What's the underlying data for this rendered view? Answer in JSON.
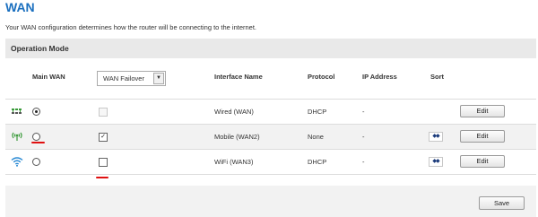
{
  "page": {
    "title": "WAN",
    "description": "Your WAN configuration determines how the router will be connecting to the internet."
  },
  "panel": {
    "title": "Operation Mode"
  },
  "table": {
    "headers": {
      "main_wan": "Main WAN",
      "interface_name": "Interface Name",
      "protocol": "Protocol",
      "ip_address": "IP Address",
      "sort": "Sort"
    },
    "mode_select": {
      "selected": "WAN Failover"
    },
    "rows": [
      {
        "icon": "wired-ethernet-icon",
        "main_wan_selected": true,
        "failover_checked": false,
        "failover_enabled": false,
        "interface_name": "Wired (WAN)",
        "protocol": "DHCP",
        "ip_address": "-",
        "has_sort": false,
        "edit_label": "Edit"
      },
      {
        "icon": "mobile-antenna-icon",
        "main_wan_selected": false,
        "failover_checked": true,
        "failover_enabled": true,
        "interface_name": "Mobile (WAN2)",
        "protocol": "None",
        "ip_address": "-",
        "has_sort": true,
        "sort_glyph": "◆◆",
        "edit_label": "Edit"
      },
      {
        "icon": "wifi-icon",
        "main_wan_selected": false,
        "failover_checked": false,
        "failover_enabled": true,
        "interface_name": "WiFi (WAN3)",
        "protocol": "DHCP",
        "ip_address": "-",
        "has_sort": true,
        "sort_glyph": "◆◆",
        "edit_label": "Edit"
      }
    ]
  },
  "footer": {
    "save_label": "Save"
  },
  "colors": {
    "title": "#1a6fbf",
    "panel_bg": "#e9e9e9",
    "annotation_red": "#e01010",
    "wired_icon_green": "#3a9a3a",
    "wifi_icon_blue": "#2a8ad4"
  }
}
